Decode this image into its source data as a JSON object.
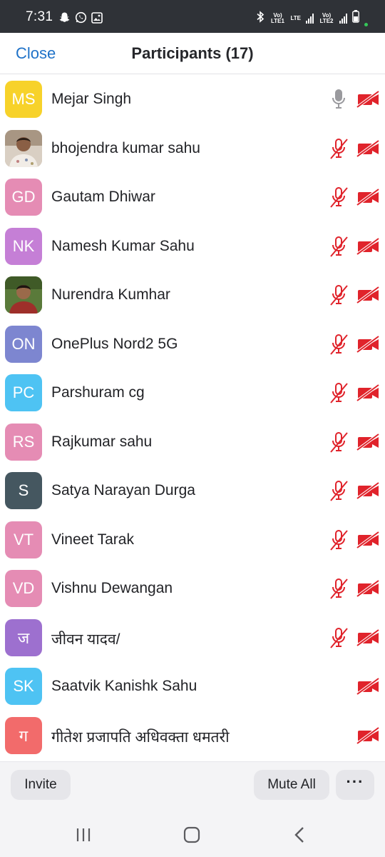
{
  "status_bar": {
    "time": "7:31",
    "sim1_label": "Vo) LTE1",
    "sim2_label": "Vo) LTE2",
    "network_label": "LTE"
  },
  "header": {
    "close_label": "Close",
    "title": "Participants (17)"
  },
  "participants": [
    {
      "initials": "MS",
      "name": "Mejar Singh",
      "color": "#f7d22a",
      "photo": false,
      "mic": "on",
      "video": "off"
    },
    {
      "initials": "",
      "name": "bhojendra kumar sahu",
      "color": "#b49a80",
      "photo": true,
      "mic": "muted",
      "video": "off"
    },
    {
      "initials": "GD",
      "name": "Gautam Dhiwar",
      "color": "#e58cb4",
      "photo": false,
      "mic": "muted",
      "video": "off"
    },
    {
      "initials": "NK",
      "name": "Namesh Kumar Sahu",
      "color": "#c57fd6",
      "photo": false,
      "mic": "muted",
      "video": "off"
    },
    {
      "initials": "",
      "name": "Nurendra Kumhar",
      "color": "#4e6b33",
      "photo": true,
      "mic": "muted",
      "video": "off"
    },
    {
      "initials": "ON",
      "name": "OnePlus Nord2 5G",
      "color": "#7d86d0",
      "photo": false,
      "mic": "muted",
      "video": "off"
    },
    {
      "initials": "PC",
      "name": "Parshuram cg",
      "color": "#4ec3f3",
      "photo": false,
      "mic": "muted",
      "video": "off"
    },
    {
      "initials": "RS",
      "name": "Rajkumar sahu",
      "color": "#e58cb4",
      "photo": false,
      "mic": "muted",
      "video": "off"
    },
    {
      "initials": "S",
      "name": "Satya Narayan Durga",
      "color": "#455760",
      "photo": false,
      "mic": "muted",
      "video": "off"
    },
    {
      "initials": "VT",
      "name": "Vineet Tarak",
      "color": "#e58cb4",
      "photo": false,
      "mic": "muted",
      "video": "off"
    },
    {
      "initials": "VD",
      "name": "Vishnu Dewangan",
      "color": "#e58cb4",
      "photo": false,
      "mic": "muted",
      "video": "off"
    },
    {
      "initials": "ज",
      "name": "जीवन यादव/",
      "color": "#9d70cf",
      "photo": false,
      "mic": "muted",
      "video": "off"
    },
    {
      "initials": "SK",
      "name": "Saatvik Kanishk Sahu",
      "color": "#4ec3f3",
      "photo": false,
      "mic": "none",
      "video": "off"
    },
    {
      "initials": "ग",
      "name": "गीतेश प्रजापति अधिवक्ता धमतरी",
      "color": "#f26b6b",
      "photo": false,
      "mic": "none",
      "video": "off"
    }
  ],
  "toolbar": {
    "invite_label": "Invite",
    "mute_all_label": "Mute All",
    "more_label": "···"
  },
  "colors": {
    "accent": "#1f72c8",
    "muted_red": "#e0232b",
    "mic_on_gray": "#9a9a9e"
  }
}
